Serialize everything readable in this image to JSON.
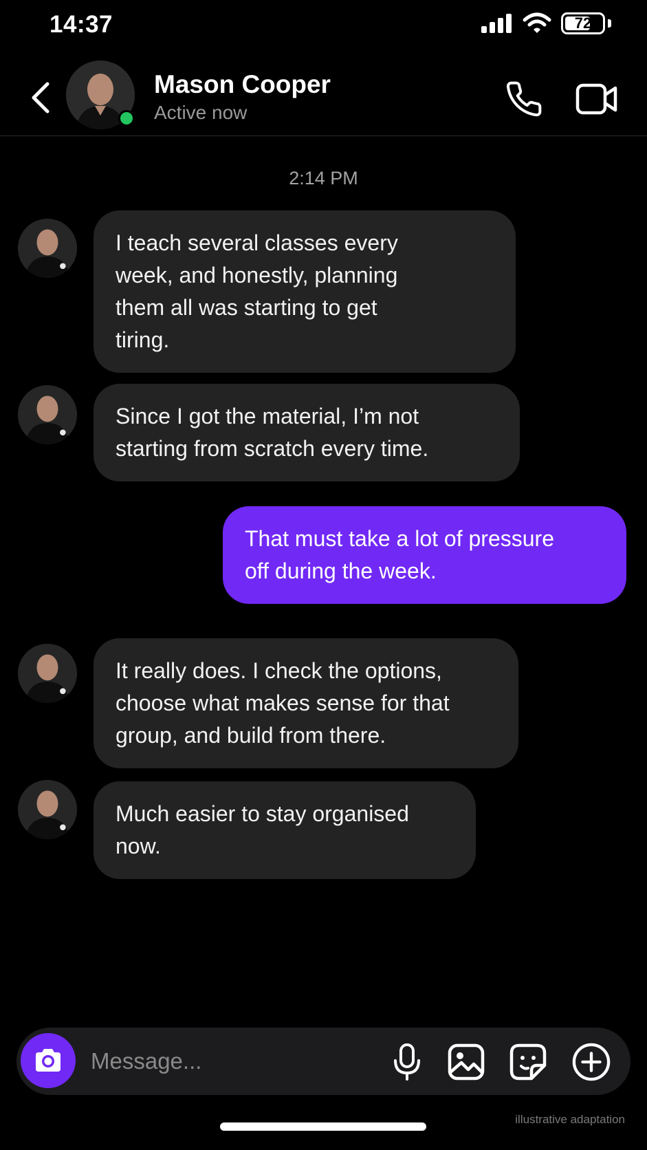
{
  "status_bar": {
    "time": "14:37",
    "battery": "72",
    "battery_level": 0.72
  },
  "header": {
    "contact_name": "Mason Cooper",
    "contact_status": "Active now",
    "online_color": "#22c55e"
  },
  "conversation": {
    "timestamp": "2:14 PM",
    "messages": [
      {
        "direction": "incoming",
        "text": "I teach several classes every\nweek, and honestly, planning\nthem all was starting to get\ntiring."
      },
      {
        "direction": "incoming",
        "text": "Since I got the material, I’m not\nstarting from scratch every time."
      },
      {
        "direction": "outgoing",
        "text": "That must take a lot of pressure\noff during the week."
      },
      {
        "direction": "incoming",
        "text": "It really does. I check the options,\nchoose what makes sense for that\ngroup, and build from there."
      },
      {
        "direction": "incoming",
        "text": "Much easier to stay organised\nnow."
      }
    ]
  },
  "composer": {
    "placeholder": "Message...",
    "icons": [
      "camera-icon",
      "microphone-icon",
      "gallery-icon",
      "sticker-icon",
      "plus-circle-icon"
    ]
  },
  "footer": {
    "watermark": "illustrative adaptation"
  },
  "colors": {
    "accent": "#7129f5",
    "incoming_bubble": "#232323",
    "background": "#000000"
  }
}
